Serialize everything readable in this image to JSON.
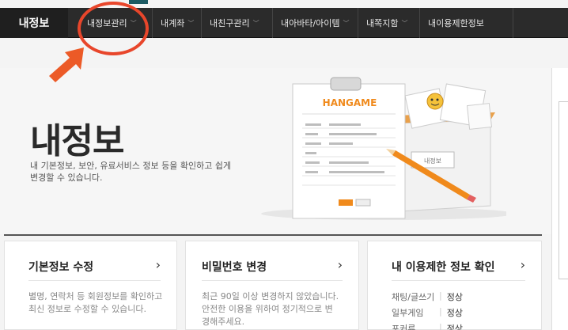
{
  "nav": {
    "home": "내정보",
    "items": [
      {
        "label": "내정보관리",
        "has_menu": true
      },
      {
        "label": "내계좌",
        "has_menu": true
      },
      {
        "label": "내친구관리",
        "has_menu": true
      },
      {
        "label": "내아바타/아이템",
        "has_menu": true
      },
      {
        "label": "내쪽지함",
        "has_menu": true
      },
      {
        "label": "내이용제한정보",
        "has_menu": false
      }
    ]
  },
  "hero": {
    "title": "내정보",
    "desc": "내 기본정보, 보안, 유료서비스 정보 등을 확인하고 쉽게 변경할 수 있습니다.",
    "illus": {
      "brand": "HANGAME",
      "box_label": "내정보"
    }
  },
  "cards": [
    {
      "title": "기본정보 수정",
      "text": "별명, 연락처 등 회원정보를 확인하고 최신 정보로 수정할 수 있습니다."
    },
    {
      "title": "비밀번호 변경",
      "text": "최근 90일 이상 변경하지 않았습니다. 안전한 이용을 위하여 정기적으로 변경해주세요."
    },
    {
      "title": "내 이용제한 정보 확인",
      "rows": [
        {
          "key": "채팅/글쓰기",
          "value": "정상"
        },
        {
          "key": "일부게임",
          "value": "정상"
        },
        {
          "key": "포커류",
          "value": "정상"
        }
      ]
    }
  ],
  "colors": {
    "accent": "#e8462b",
    "nav_bg": "#2b2b2b",
    "brand_orange": "#f08a1c"
  }
}
